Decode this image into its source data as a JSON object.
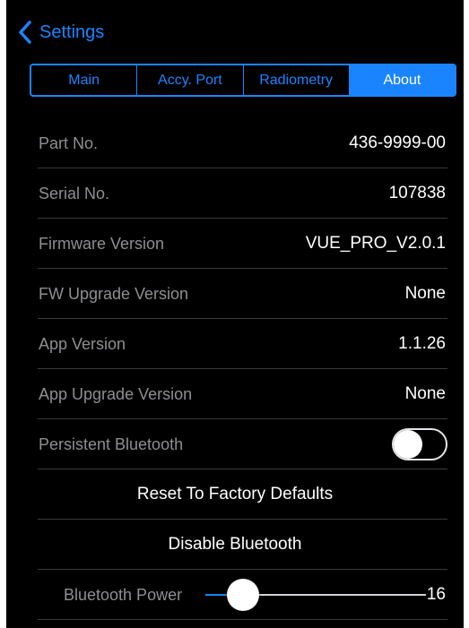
{
  "nav": {
    "back_label": "Settings",
    "back_icon": "chevron-left-icon"
  },
  "tabs": [
    {
      "label": "Main",
      "active": false
    },
    {
      "label": "Accy. Port",
      "active": false
    },
    {
      "label": "Radiometry",
      "active": false
    },
    {
      "label": "About",
      "active": true
    }
  ],
  "info": [
    {
      "label": "Part No.",
      "value": "436-9999-00"
    },
    {
      "label": "Serial No.",
      "value": "107838"
    },
    {
      "label": "Firmware Version",
      "value": "VUE_PRO_V2.0.1"
    },
    {
      "label": "FW Upgrade Version",
      "value": "None"
    },
    {
      "label": "App Version",
      "value": "1.1.26"
    },
    {
      "label": "App Upgrade Version",
      "value": "None"
    }
  ],
  "persistent_bluetooth": {
    "label": "Persistent Bluetooth",
    "enabled": false
  },
  "actions": {
    "reset_label": "Reset To Factory Defaults",
    "disable_bt_label": "Disable Bluetooth"
  },
  "bluetooth_power": {
    "label": "Bluetooth Power",
    "value": "16",
    "fraction": 0.17
  },
  "colors": {
    "accent": "#1a84ff",
    "background": "#000000",
    "label": "#8e8e93",
    "divider": "#3a3a3c"
  }
}
